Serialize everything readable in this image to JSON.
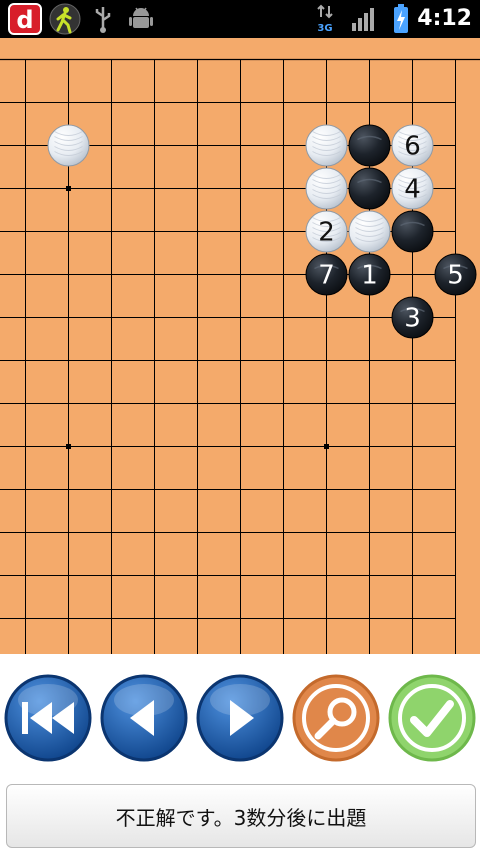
{
  "status_bar": {
    "time": "4:12",
    "network": "3G",
    "icons": [
      "docomo-d-icon",
      "walker-icon",
      "usb-icon",
      "android-debug-icon",
      "data-arrows-icon",
      "signal-icon",
      "battery-charging-icon"
    ]
  },
  "board": {
    "line_color": "#000000",
    "background": "#f4aa6b",
    "stones": [
      {
        "color": "white",
        "col": 1,
        "row": 2,
        "label": ""
      },
      {
        "color": "white",
        "col": 7,
        "row": 2,
        "label": ""
      },
      {
        "color": "black",
        "col": 8,
        "row": 2,
        "label": ""
      },
      {
        "color": "white",
        "col": 9,
        "row": 2,
        "label": "6"
      },
      {
        "color": "white",
        "col": 7,
        "row": 3,
        "label": ""
      },
      {
        "color": "black",
        "col": 8,
        "row": 3,
        "label": ""
      },
      {
        "color": "white",
        "col": 9,
        "row": 3,
        "label": "4"
      },
      {
        "color": "white",
        "col": 7,
        "row": 4,
        "label": "2"
      },
      {
        "color": "white",
        "col": 8,
        "row": 4,
        "label": ""
      },
      {
        "color": "black",
        "col": 9,
        "row": 4,
        "label": ""
      },
      {
        "color": "black",
        "col": 7,
        "row": 5,
        "label": "7"
      },
      {
        "color": "black",
        "col": 8,
        "row": 5,
        "label": "1"
      },
      {
        "color": "black",
        "col": 10,
        "row": 5,
        "label": "5"
      },
      {
        "color": "black",
        "col": 9,
        "row": 6,
        "label": "3"
      }
    ],
    "star_points": [
      {
        "col": 1,
        "row": 3
      },
      {
        "col": 1,
        "row": 9
      },
      {
        "col": 7,
        "row": 9
      }
    ]
  },
  "controls": {
    "buttons": [
      {
        "name": "first-move-button",
        "icon": "rewind-double-icon"
      },
      {
        "name": "prev-move-button",
        "icon": "triangle-left-icon"
      },
      {
        "name": "next-move-button",
        "icon": "triangle-right-icon"
      },
      {
        "name": "hint-search-button",
        "icon": "magnifier-icon"
      },
      {
        "name": "confirm-button",
        "icon": "checkmark-icon"
      }
    ],
    "colors": {
      "blue": "#1f5fb4",
      "orange": "#e08a4a",
      "green": "#8fd46c"
    }
  },
  "message": "不正解です。3数分後に出題"
}
